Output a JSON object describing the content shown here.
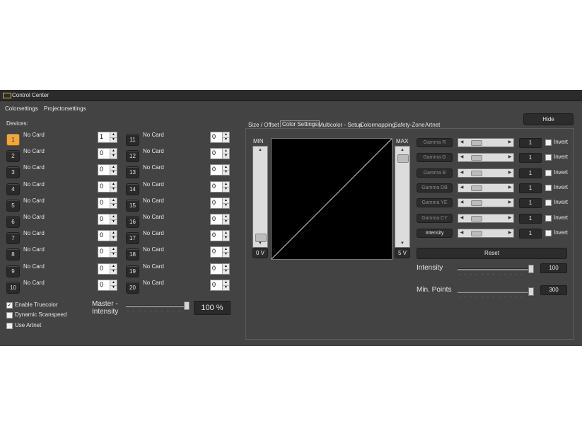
{
  "window": {
    "title": "Control Center"
  },
  "menu": {
    "colorsettings": "Colorsettings",
    "projectorsettings": "Projectorsettings"
  },
  "devices": {
    "label": "Devices:",
    "items": [
      {
        "num": "1",
        "name": "No Card",
        "value": "1"
      },
      {
        "num": "2",
        "name": "No Card",
        "value": "0"
      },
      {
        "num": "3",
        "name": "No Card",
        "value": "0"
      },
      {
        "num": "4",
        "name": "No Card",
        "value": "0"
      },
      {
        "num": "5",
        "name": "No Card",
        "value": "0"
      },
      {
        "num": "6",
        "name": "No Card",
        "value": "0"
      },
      {
        "num": "7",
        "name": "No Card",
        "value": "0"
      },
      {
        "num": "8",
        "name": "No Card",
        "value": "0"
      },
      {
        "num": "9",
        "name": "No Card",
        "value": "0"
      },
      {
        "num": "10",
        "name": "No Card",
        "value": "0"
      },
      {
        "num": "11",
        "name": "No Card",
        "value": "0"
      },
      {
        "num": "12",
        "name": "No Card",
        "value": "0"
      },
      {
        "num": "13",
        "name": "No Card",
        "value": "0"
      },
      {
        "num": "14",
        "name": "No Card",
        "value": "0"
      },
      {
        "num": "15",
        "name": "No Card",
        "value": "0"
      },
      {
        "num": "16",
        "name": "No Card",
        "value": "0"
      },
      {
        "num": "17",
        "name": "No Card",
        "value": "0"
      },
      {
        "num": "18",
        "name": "No Card",
        "value": "0"
      },
      {
        "num": "19",
        "name": "No Card",
        "value": "0"
      },
      {
        "num": "20",
        "name": "No Card",
        "value": "0"
      }
    ]
  },
  "options": {
    "enable_truecolor": "Enable Truecolor",
    "dynamic_scanspeed": "Dynamic Scanspeed",
    "use_artnet": "Use Artnet"
  },
  "master": {
    "label": "Master -\nIntensity",
    "value": "100 %",
    "level": 1.0
  },
  "hide_button": "Hide",
  "tabs": [
    "Size / Offset",
    "Color Settings",
    "Multicolor - Setup",
    "Colormapping",
    "Safety-Zone",
    "Artnet"
  ],
  "curve": {
    "min_label": "MIN",
    "max_label": "MAX",
    "min_value": "0 V",
    "max_value": "5 V"
  },
  "gamma": [
    {
      "label": "Gamma R",
      "value": "1",
      "invert": "Invert"
    },
    {
      "label": "Gamma G",
      "value": "1",
      "invert": "Invert"
    },
    {
      "label": "Gamma B",
      "value": "1",
      "invert": "Invert"
    },
    {
      "label": "Gamma DB",
      "value": "1",
      "invert": "Invert"
    },
    {
      "label": "Gamma YE",
      "value": "1",
      "invert": "Invert"
    },
    {
      "label": "Gamma CY",
      "value": "1",
      "invert": "Invert"
    },
    {
      "label": "Intensity",
      "value": "1",
      "invert": "Invert"
    }
  ],
  "reset_button": "Reset",
  "intensity": {
    "label": "Intensity",
    "value": "100",
    "level": 1.0
  },
  "min_points": {
    "label": "Min. Points",
    "value": "300",
    "level": 1.0
  },
  "colors": {
    "accent": "#f2a640",
    "window_bg": "#434343",
    "titlebar_bg": "#2b2b2b"
  }
}
